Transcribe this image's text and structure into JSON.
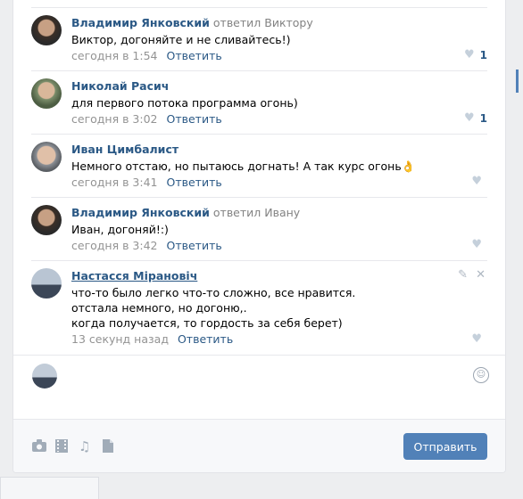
{
  "comments": [
    {
      "author": "Владимир Янковский",
      "reply_to": "ответил Виктору",
      "text": [
        "Виктор, догоняйте и не сливайтесь!)"
      ],
      "time": "сегодня в 1:54",
      "reply_label": "Ответить",
      "likes": "1",
      "avatar": "vladimir"
    },
    {
      "author": "Николай Расич",
      "reply_to": "",
      "text": [
        "для первого потока программа огонь)"
      ],
      "time": "сегодня в 3:02",
      "reply_label": "Ответить",
      "likes": "1",
      "avatar": "nikolai"
    },
    {
      "author": "Иван Цимбалист",
      "reply_to": "",
      "text": [
        "Немного отстаю, но пытаюсь догнать! А так курс огонь👌"
      ],
      "time": "сегодня в 3:41",
      "reply_label": "Ответить",
      "likes": "",
      "avatar": "ivan"
    },
    {
      "author": "Владимир Янковский",
      "reply_to": "ответил Ивану",
      "text": [
        "Иван, догоняй!:)"
      ],
      "time": "сегодня в 3:42",
      "reply_label": "Ответить",
      "likes": "",
      "avatar": "vladimir"
    },
    {
      "author": "Настасся Мірановіч",
      "reply_to": "",
      "text": [
        "что-то было легко что-то сложно, все нравится.",
        "отстала немного, но догоню,.",
        "когда получается, то гордость за себя берет)"
      ],
      "time": "13 секунд назад",
      "reply_label": "Ответить",
      "likes": "",
      "avatar": "nastassia"
    }
  ],
  "composer": {
    "send_label": "Отправить",
    "tools": [
      "camera-icon",
      "video-icon",
      "music-icon",
      "document-icon"
    ],
    "emoji_icon": "smile-icon"
  },
  "colors": {
    "link": "#2a5885",
    "button": "#5181b8",
    "meta": "#939393",
    "like_icon": "#c5d0db"
  }
}
